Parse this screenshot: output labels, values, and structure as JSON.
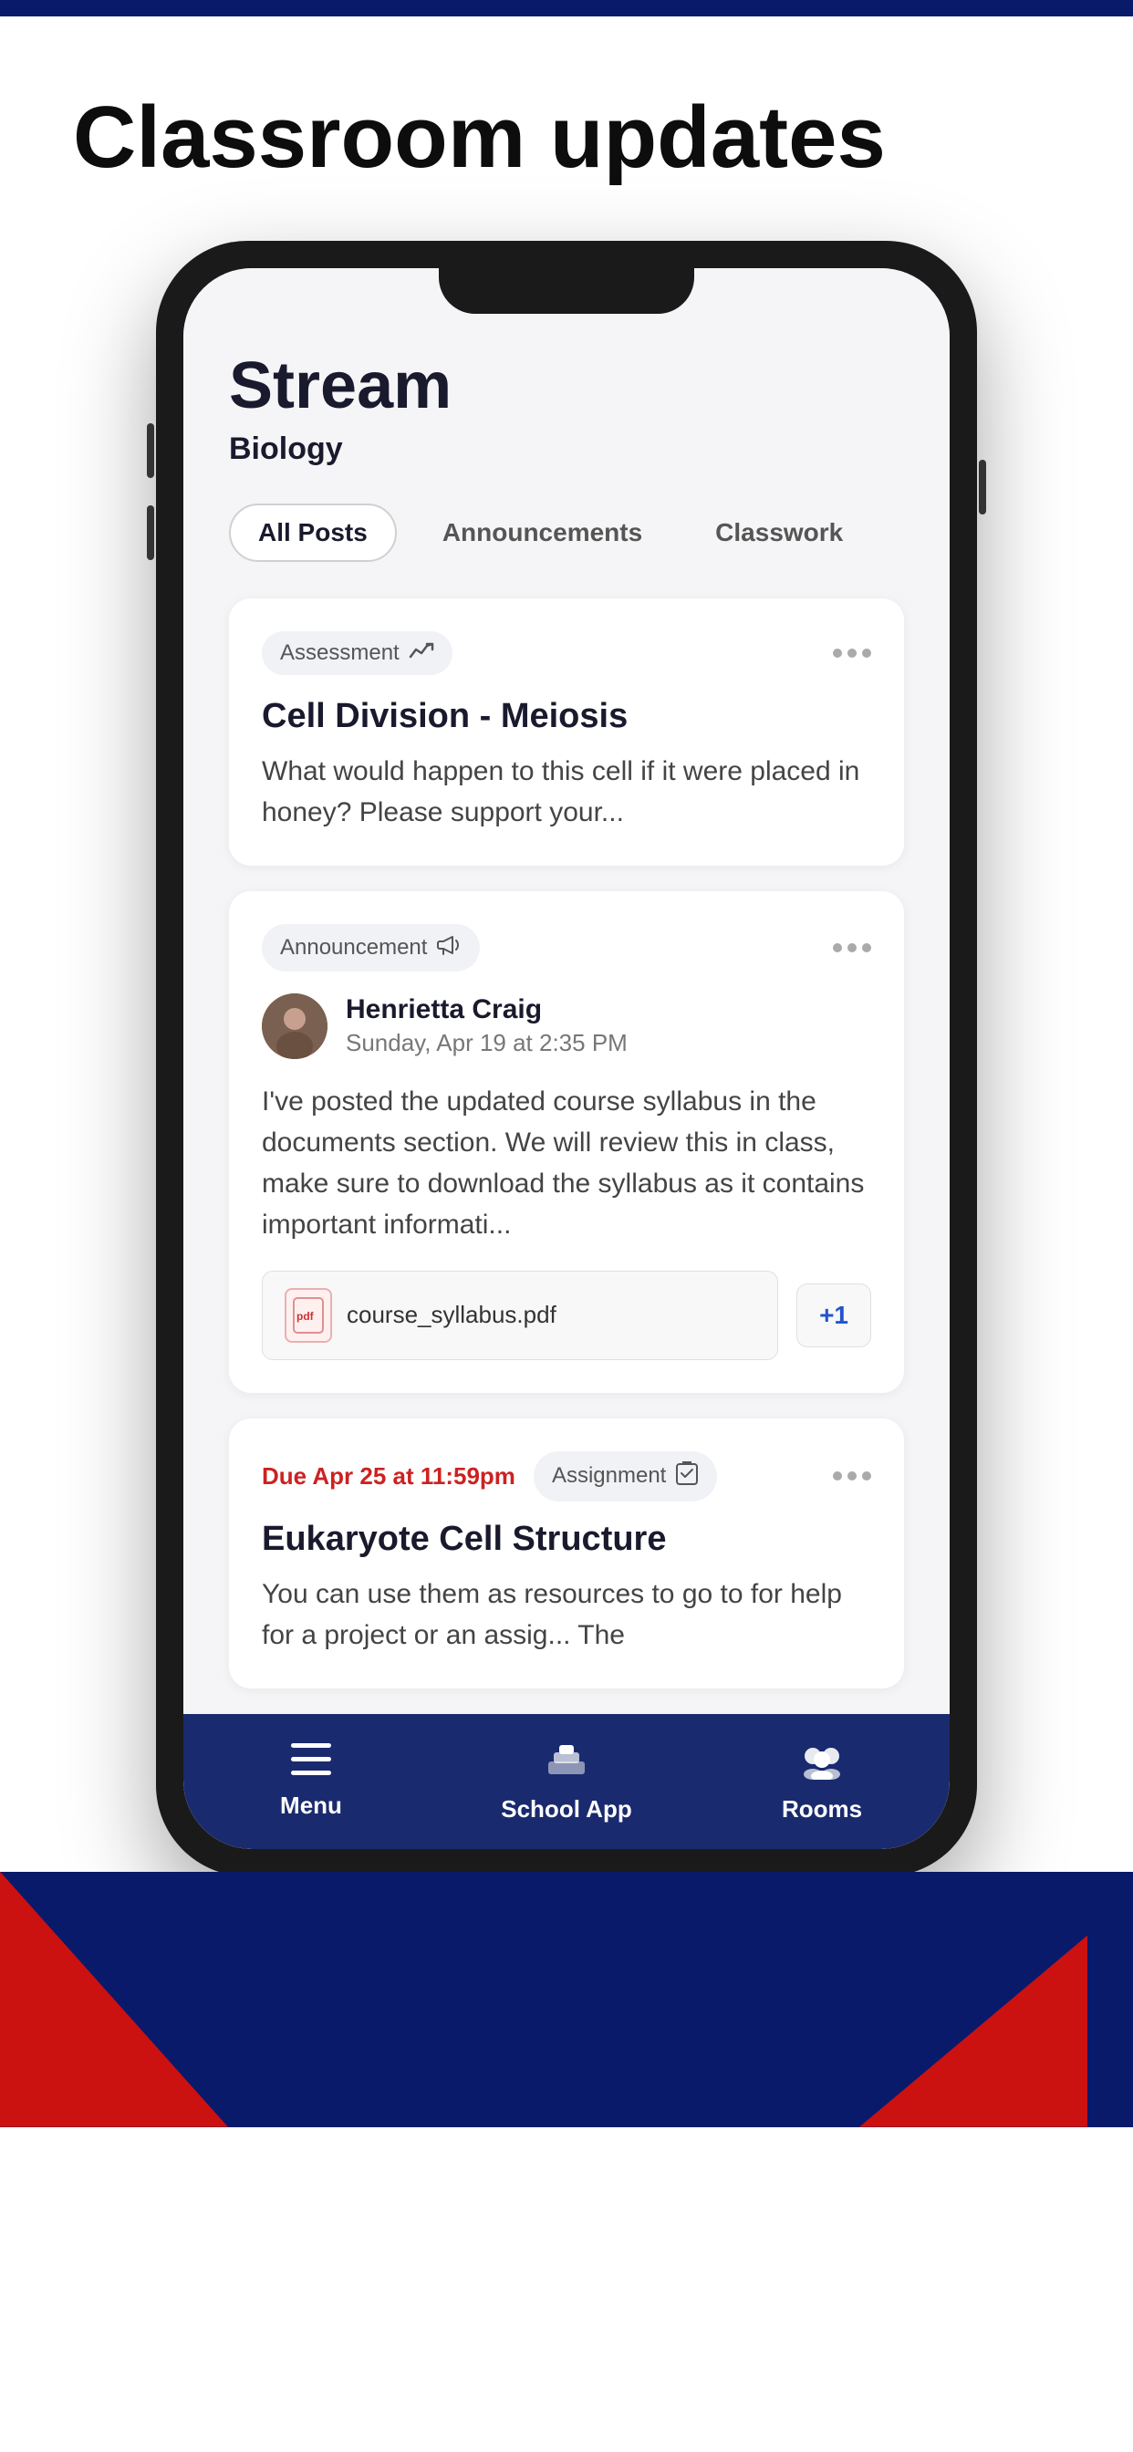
{
  "topBar": {
    "color": "#0a1a6b"
  },
  "hero": {
    "title": "Classroom updates"
  },
  "phone": {
    "stream": {
      "title": "Stream",
      "subject": "Biology"
    },
    "tabs": [
      {
        "label": "All Posts",
        "active": true
      },
      {
        "label": "Announcements",
        "active": false
      },
      {
        "label": "Classwork",
        "active": false
      }
    ],
    "cards": [
      {
        "type": "assessment",
        "tagLabel": "Assessment",
        "tagIcon": "chart-icon",
        "title": "Cell Division - Meiosis",
        "body": "What would happen to this cell if it were placed in honey? Please support your..."
      },
      {
        "type": "announcement",
        "tagLabel": "Announcement",
        "tagIcon": "megaphone-icon",
        "authorName": "Henrietta Craig",
        "authorDate": "Sunday, Apr 19 at 2:35 PM",
        "body": "I've posted the updated course syllabus in the documents section. We will review this in class, make sure to download the syllabus as it contains important informati...",
        "attachment": "course_syllabus.pdf",
        "attachmentExtra": "+1"
      },
      {
        "type": "assignment",
        "dueLabel": "Due Apr 25 at 11:59pm",
        "tagLabel": "Assignment",
        "tagIcon": "clipboard-icon",
        "title": "Eukaryote Cell Structure",
        "body": "You can use them as resources to go to for help for a project or an assig... The"
      }
    ],
    "bottomNav": [
      {
        "label": "Menu",
        "icon": "menu-icon"
      },
      {
        "label": "School App",
        "icon": "school-icon"
      },
      {
        "label": "Rooms",
        "icon": "rooms-icon"
      }
    ]
  }
}
